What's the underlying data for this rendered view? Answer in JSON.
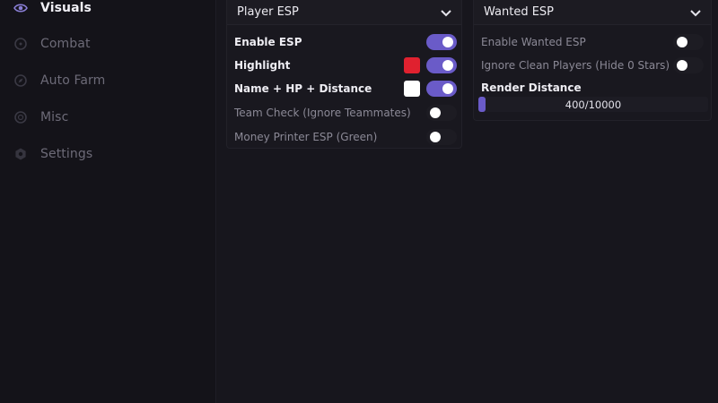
{
  "sidebar": {
    "items": [
      {
        "label": "Visuals",
        "icon": "eye-icon",
        "active": true
      },
      {
        "label": "Combat",
        "icon": "crosshair-icon",
        "active": false
      },
      {
        "label": "Auto Farm",
        "icon": "compass-icon",
        "active": false
      },
      {
        "label": "Misc",
        "icon": "circle-icon",
        "active": false
      },
      {
        "label": "Settings",
        "icon": "gear-icon",
        "active": false
      }
    ]
  },
  "player_esp": {
    "title": "Player ESP",
    "rows": [
      {
        "label": "Enable ESP",
        "enabled": true
      },
      {
        "label": "Highlight",
        "enabled": true,
        "color": "#e0212f"
      },
      {
        "label": "Name + HP + Distance",
        "enabled": true,
        "color": "#ffffff"
      },
      {
        "label": "Team Check (Ignore Teammates)",
        "enabled": false
      },
      {
        "label": "Money Printer ESP (Green)",
        "enabled": false
      }
    ]
  },
  "wanted_esp": {
    "title": "Wanted ESP",
    "rows": [
      {
        "label": "Enable Wanted ESP",
        "enabled": false
      },
      {
        "label": "Ignore Clean Players (Hide 0 Stars)",
        "enabled": false
      }
    ],
    "render_distance": {
      "label": "Render Distance",
      "value_text": "400/10000",
      "value": 400,
      "max": 10000
    }
  },
  "colors": {
    "accent": "#6a5bc8",
    "background": "#16151c",
    "panel": "#19181f"
  }
}
